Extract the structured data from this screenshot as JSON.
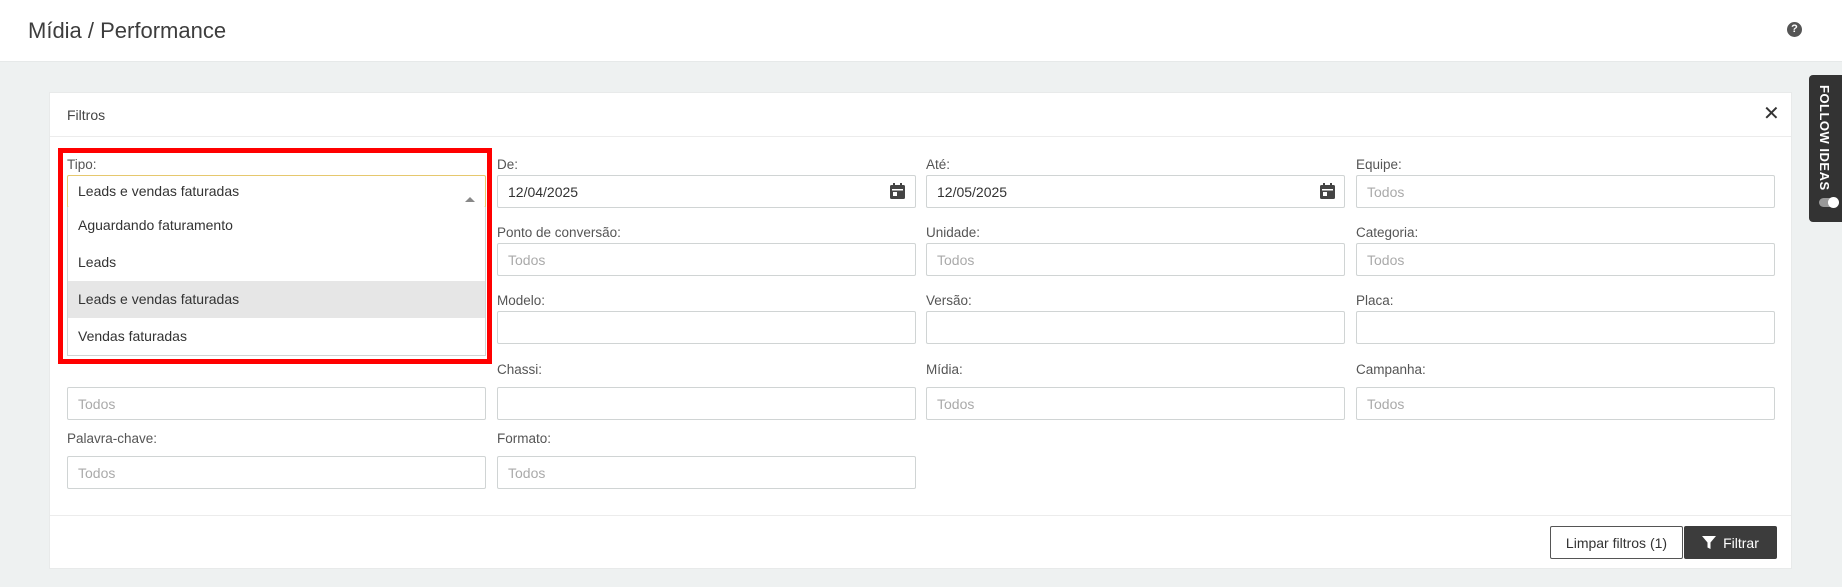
{
  "header": {
    "title": "Mídia / Performance",
    "help_icon": "question-circle-icon"
  },
  "filters": {
    "panel_title": "Filtros",
    "tipo": {
      "label": "Tipo:",
      "value": "Leads e vendas faturadas",
      "options": [
        "Aguardando faturamento",
        "Leads",
        "Leads e vendas faturadas",
        "Vendas faturadas"
      ],
      "selected_index": 2
    },
    "de": {
      "label": "De:",
      "value": "12/04/2025"
    },
    "ate": {
      "label": "Até:",
      "value": "12/05/2025"
    },
    "equipe": {
      "label": "Equipe:",
      "placeholder": "Todos"
    },
    "ponto_conversao": {
      "label": "Ponto de conversão:",
      "placeholder": "Todos"
    },
    "unidade": {
      "label": "Unidade:",
      "placeholder": "Todos"
    },
    "categoria": {
      "label": "Categoria:",
      "placeholder": "Todos"
    },
    "modelo": {
      "label": "Modelo:",
      "placeholder": ""
    },
    "versao": {
      "label": "Versão:",
      "placeholder": ""
    },
    "placa": {
      "label": "Placa:",
      "placeholder": ""
    },
    "hidden_row4": {
      "placeholder": "Todos"
    },
    "chassi": {
      "label": "Chassi:",
      "placeholder": ""
    },
    "midia": {
      "label": "Mídia:",
      "placeholder": "Todos"
    },
    "campanha": {
      "label": "Campanha:",
      "placeholder": "Todos"
    },
    "palavra_chave": {
      "label": "Palavra-chave:",
      "placeholder": "Todos"
    },
    "formato": {
      "label": "Formato:",
      "placeholder": "Todos"
    },
    "buttons": {
      "clear": "Limpar filtros (1)",
      "filter": "Filtrar"
    }
  },
  "follow_tab": {
    "label": "FOLLOW IDEAS"
  },
  "colors": {
    "highlight": "#ff0000",
    "primary_button": "#3c3c3c",
    "background": "#eef1f1"
  }
}
